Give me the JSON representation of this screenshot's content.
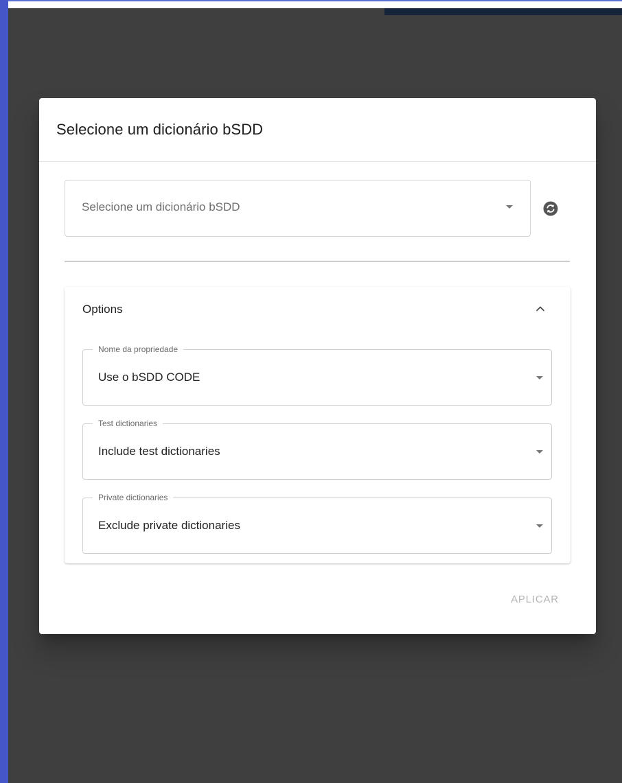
{
  "dialog": {
    "title": "Selecione um dicionário bSDD"
  },
  "dictionary_select": {
    "placeholder": "Selecione um dicionário bSDD",
    "dropdown_icon": "caret-down-icon",
    "refresh_icon": "refresh-icon"
  },
  "options": {
    "title": "Options",
    "toggle_icon": "chevron-up-icon",
    "fields": [
      {
        "label": "Nome da propriedade",
        "value": "Use o bSDD CODE"
      },
      {
        "label": "Test dictionaries",
        "value": "Include test dictionaries"
      },
      {
        "label": "Private dictionaries",
        "value": "Exclude private dictionaries"
      }
    ]
  },
  "actions": {
    "apply_label": "APLICAR"
  },
  "colors": {
    "backdrop": "#3f3f3f",
    "frame_accent": "#4556c9",
    "refresh_icon": "#555555",
    "apply_disabled": "#b4b4b4"
  }
}
